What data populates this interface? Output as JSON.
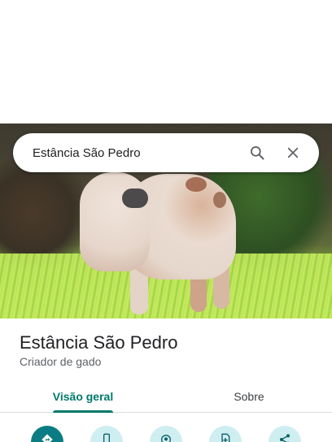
{
  "search": {
    "query": "Estância São Pedro",
    "search_icon": "search-icon",
    "close_icon": "close-icon"
  },
  "place": {
    "title": "Estância São Pedro",
    "category": "Criador de gado"
  },
  "tabs": [
    {
      "label": "Visão geral",
      "active": true
    },
    {
      "label": "Sobre",
      "active": false
    }
  ],
  "actions": [
    {
      "icon": "directions-icon",
      "style": "primary"
    },
    {
      "icon": "phone-icon",
      "style": "secondary"
    },
    {
      "icon": "nearby-icon",
      "style": "secondary"
    },
    {
      "icon": "save-icon",
      "style": "secondary"
    },
    {
      "icon": "share-icon",
      "style": "secondary"
    }
  ],
  "colors": {
    "accent": "#00796b",
    "primary_action": "#0b7c83",
    "secondary_action": "#cfeef1"
  }
}
